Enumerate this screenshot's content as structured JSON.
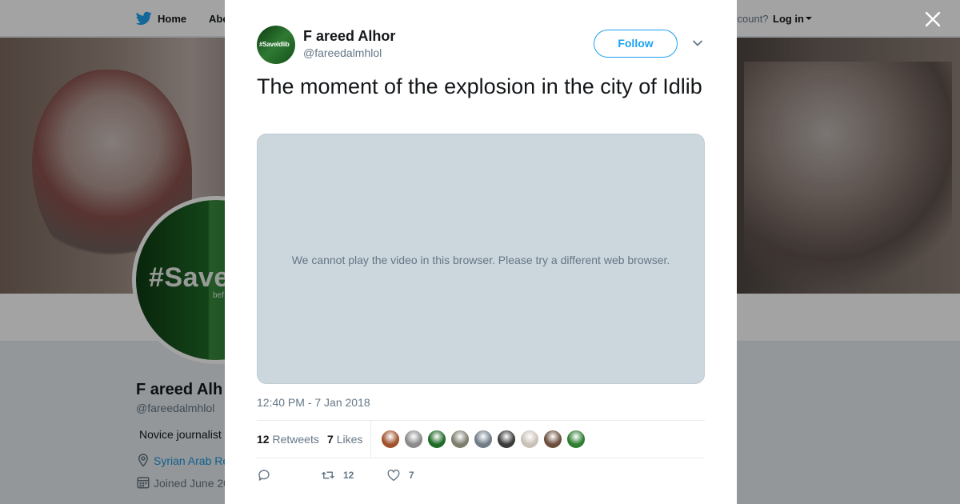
{
  "topbar": {
    "home_label": "Home",
    "about_label": "Abo",
    "account_prompt": "ccount?",
    "login_label": "Log in"
  },
  "profile": {
    "avatar_text": "#Save",
    "avatar_subtext": "bef",
    "name": "F areed Alh",
    "handle": "@fareedalmhlol",
    "bio": "Novice journalist",
    "location": "Syrian Arab Re",
    "joined": "Joined June 20"
  },
  "tweet": {
    "avatar_text": "#SaveIdlib",
    "author_name": "F areed Alhor",
    "author_handle": "@fareedalmhlol",
    "follow_label": "Follow",
    "text": "The moment of the explosion in the city of Idlib",
    "video_message": "We cannot play the video in this browser. Please try a different web browser.",
    "timestamp": "12:40 PM - 7 Jan 2018",
    "retweets_count": "12",
    "retweets_label": "Retweets",
    "likes_count": "7",
    "likes_label": "Likes",
    "likers": [
      {
        "color": "#a0522d"
      },
      {
        "color": "#8a8a8a"
      },
      {
        "color": "#1f6a27"
      },
      {
        "color": "#7d7d6e"
      },
      {
        "color": "#6f7c86"
      },
      {
        "color": "#3a3a3a"
      },
      {
        "color": "#c9c1b8"
      },
      {
        "color": "#6b4e3d"
      },
      {
        "color": "#2e7d32"
      }
    ],
    "actions": {
      "reply_count": "",
      "retweet_count": "12",
      "like_count": "7"
    }
  },
  "colors": {
    "accent": "#1da1f2",
    "link": "#1b95e0",
    "text_primary": "#14171a",
    "text_secondary": "#657786",
    "media_placeholder": "#ccd6dd"
  }
}
